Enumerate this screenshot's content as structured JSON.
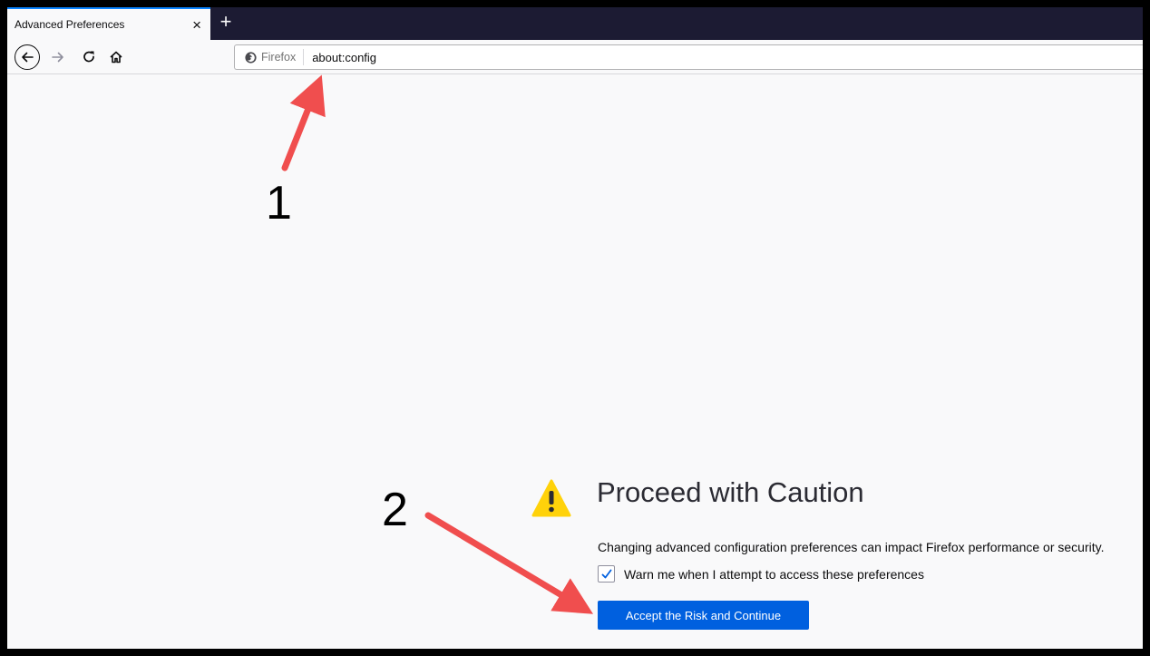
{
  "tab": {
    "title": "Advanced Preferences",
    "close_glyph": "×"
  },
  "toolbar": {
    "new_tab_glyph": "+"
  },
  "nav": {
    "back_icon": "arrow-left-icon",
    "forward_icon": "arrow-right-icon",
    "reload_icon": "reload-icon",
    "home_icon": "home-icon"
  },
  "urlbar": {
    "identity_label": "Firefox",
    "url": "about:config"
  },
  "page": {
    "heading": "Proceed with Caution",
    "description": "Changing advanced configuration preferences can impact Firefox performance or security.",
    "checkbox_label": "Warn me when I attempt to access these preferences",
    "checkbox_checked": true,
    "accept_button": "Accept the Risk and Continue"
  },
  "annotations": {
    "step1": "1",
    "step2": "2"
  },
  "colors": {
    "accent": "#0060df",
    "tabstrip": "#1c1b33",
    "warning": "#ffd20a",
    "annotation_arrow": "#f04e4e"
  }
}
